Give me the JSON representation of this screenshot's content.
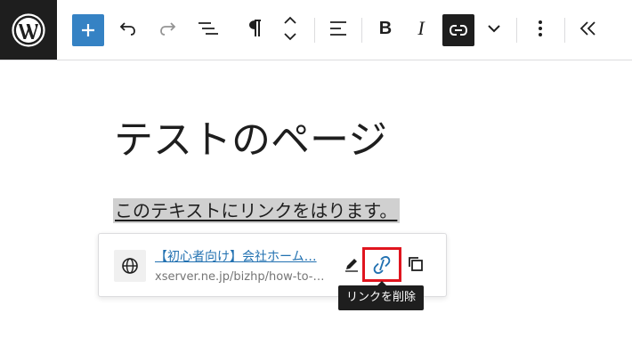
{
  "toolbar": {
    "wp_logo_icon": "wordpress-logo",
    "buttons": [
      {
        "name": "add-block",
        "icon": "plus-icon"
      },
      {
        "name": "undo",
        "icon": "undo-icon"
      },
      {
        "name": "redo",
        "icon": "redo-icon"
      },
      {
        "name": "document-overview",
        "icon": "list-view-icon"
      },
      {
        "name": "paragraph",
        "icon": "paragraph-icon"
      },
      {
        "name": "move",
        "icon": "chevron-up-down-icon"
      },
      {
        "name": "align",
        "icon": "align-left-icon"
      },
      {
        "name": "bold",
        "label": "B"
      },
      {
        "name": "italic",
        "label": "I"
      },
      {
        "name": "link",
        "icon": "link-icon",
        "active": true
      },
      {
        "name": "more-rich-text",
        "icon": "chevron-down-icon"
      },
      {
        "name": "options",
        "icon": "more-vertical-icon"
      },
      {
        "name": "collapse",
        "icon": "chevron-double-left-icon"
      }
    ],
    "bold_label": "B",
    "italic_label": "I"
  },
  "content": {
    "title": "テストのページ",
    "paragraph": "このテキストにリンクをはります。"
  },
  "link_popover": {
    "link_title": "【初心者向け】会社ホーム…",
    "link_url": "xserver.ne.jp/bizhp/how-to-ma…",
    "globe_icon": "globe-icon",
    "edit_icon": "pencil-icon",
    "unlink_icon": "unlink-icon",
    "copy_icon": "copy-icon"
  },
  "tooltip": {
    "text": "リンクを削除"
  },
  "colors": {
    "accent": "#3582c4",
    "highlight_border": "#e0151f",
    "link": "#2271b1"
  }
}
